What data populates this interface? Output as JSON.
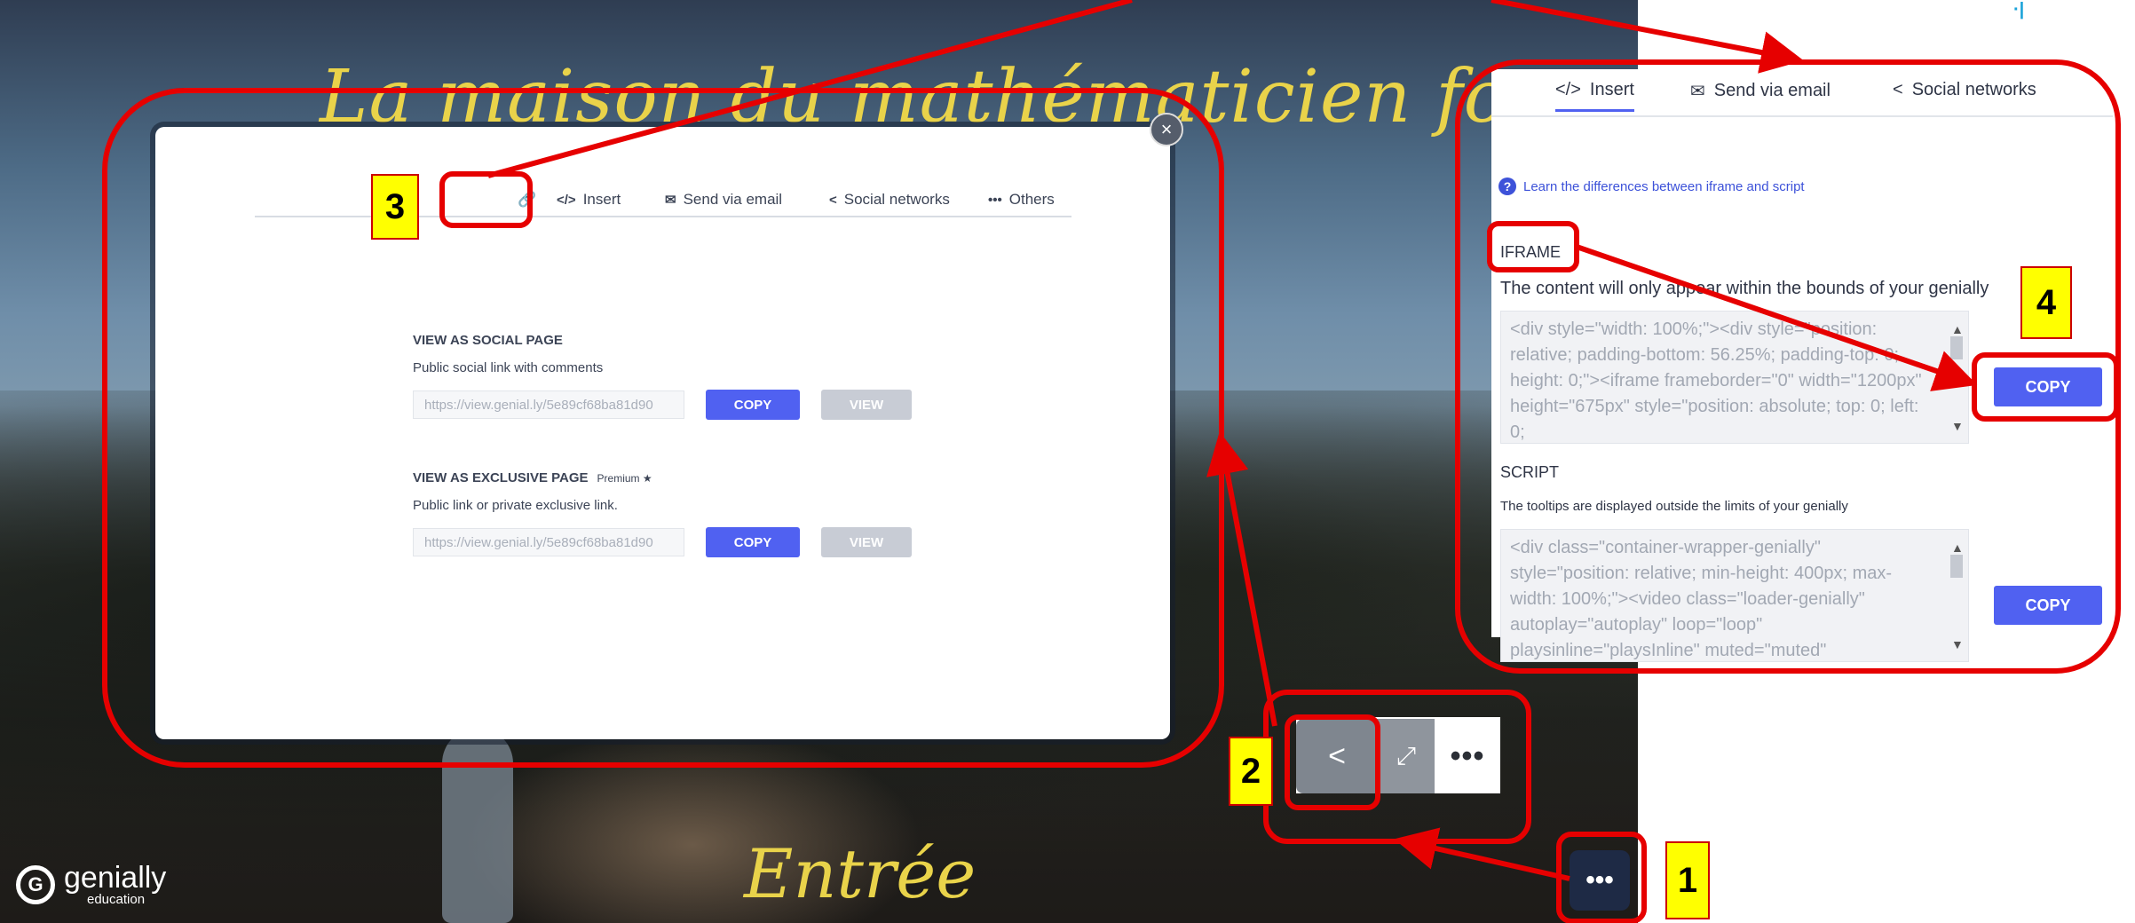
{
  "background": {
    "title": "La maison du mathématicien fou",
    "entrance": "Entrée",
    "logo": {
      "mark": "G",
      "name": "genially",
      "sub": "education"
    },
    "more_button": "•••",
    "edge_glyph": "·|"
  },
  "modal": {
    "close": "×",
    "tabs": [
      {
        "icon": "</>",
        "label": "Insert"
      },
      {
        "icon": "✉",
        "label": "Send via email"
      },
      {
        "icon": "<",
        "label": "Social networks"
      },
      {
        "icon": "•••",
        "label": "Others"
      }
    ],
    "social_page": {
      "heading": "VIEW AS SOCIAL PAGE",
      "desc": "Public social link with comments",
      "url": "https://view.genial.ly/5e89cf68ba81d90",
      "copy": "COPY",
      "view": "VIEW"
    },
    "exclusive_page": {
      "heading": "VIEW AS EXCLUSIVE PAGE",
      "premium": "Premium ★",
      "desc": "Public link or private exclusive link.",
      "url": "https://view.genial.ly/5e89cf68ba81d90",
      "copy": "COPY",
      "view": "VIEW"
    }
  },
  "toolbar": {
    "share": "<",
    "expand": "⤢",
    "more": "•••"
  },
  "panel": {
    "tabs": [
      {
        "icon": "</>",
        "label": "Insert"
      },
      {
        "icon": "✉",
        "label": "Send via email"
      },
      {
        "icon": "<",
        "label": "Social networks"
      }
    ],
    "learn": "Learn the differences between iframe and script",
    "iframe": {
      "label": "IFRAME",
      "desc": "The content will only appear within the bounds of your genially",
      "code": "<div style=\"width: 100%;\"><div style=\"position: relative; padding-bottom: 56.25%; padding-top: 0; height: 0;\"><iframe frameborder=\"0\" width=\"1200px\" height=\"675px\" style=\"position: absolute; top: 0; left: 0;",
      "copy": "COPY"
    },
    "script": {
      "label": "SCRIPT",
      "desc": "The tooltips are displayed outside the limits of your genially",
      "code": "<div class=\"container-wrapper-genially\" style=\"position: relative; min-height: 400px; max-width: 100%;\"><video class=\"loader-genially\" autoplay=\"autoplay\" loop=\"loop\" playsinline=\"playsInline\" muted=\"muted\" style=\"position:",
      "copy": "COPY"
    }
  },
  "badges": [
    "1",
    "2",
    "3",
    "4"
  ],
  "colors": {
    "annotation": "#e60000",
    "badge": "#ffff00",
    "accent": "#5061f1"
  }
}
